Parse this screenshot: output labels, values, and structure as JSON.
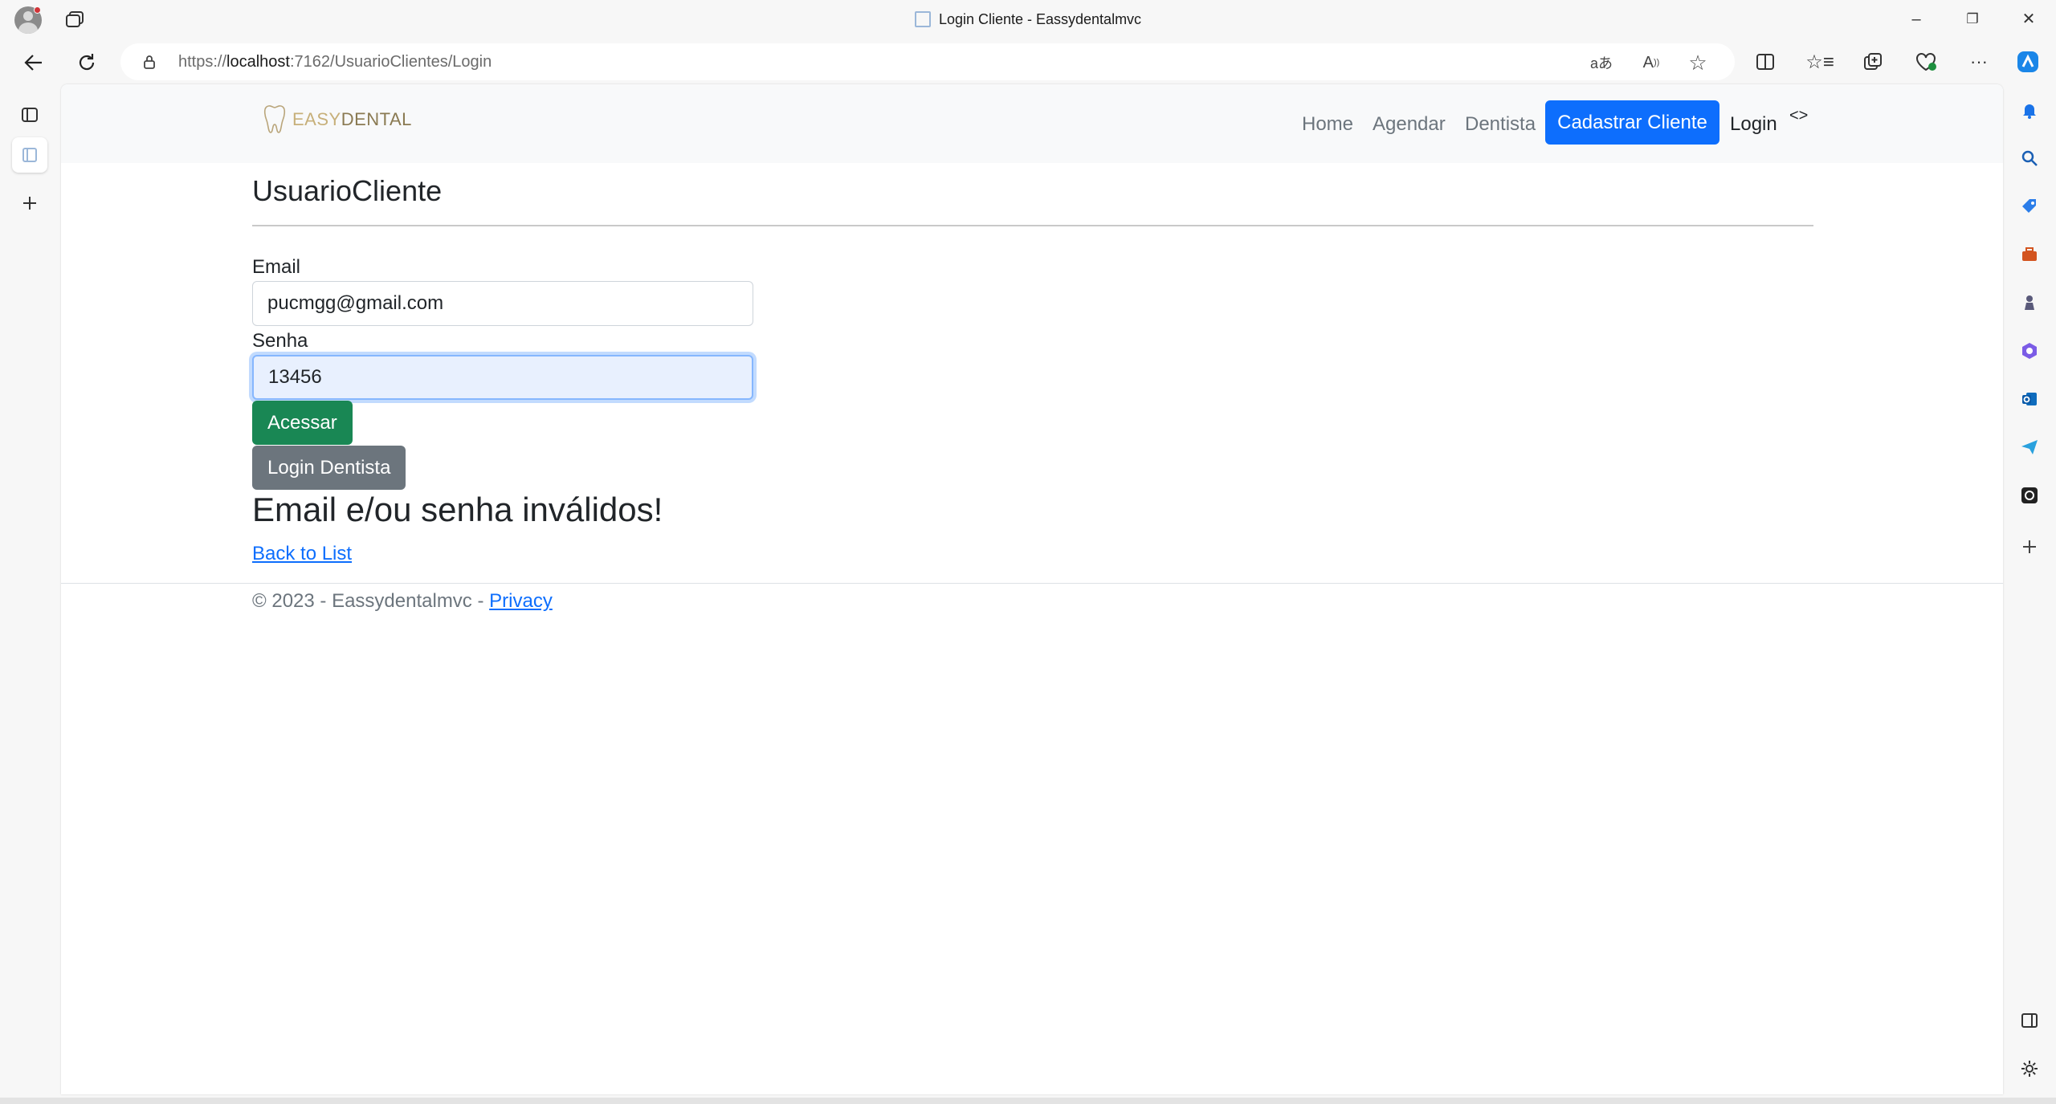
{
  "browser": {
    "window_title": "Login Cliente - Eassydentalmvc",
    "url_prefix": "https://",
    "url_host": "localhost",
    "url_rest": ":7162/UsuarioClientes/Login",
    "window_controls": {
      "minimize": "–",
      "restore": "❐",
      "close": "✕"
    },
    "more_label": "···"
  },
  "navbar": {
    "brand_prefix": "EASY",
    "brand_suffix": "DENTAL",
    "links": [
      "Home",
      "Agendar",
      "Dentista"
    ],
    "cta_label": "Cadastrar Cliente",
    "login_label": "Login",
    "chevrons": "<>"
  },
  "page": {
    "title": "UsuarioCliente",
    "email_label": "Email",
    "email_value": "pucmgg@gmail.com",
    "password_label": "Senha",
    "password_value": "13456",
    "submit_label": "Acessar",
    "dentist_login_label": "Login Dentista",
    "error_message": "Email e/ou senha inválidos!",
    "back_link": "Back to List"
  },
  "footer": {
    "copyright": "© 2023 - Eassydentalmvc - ",
    "privacy_link": "Privacy"
  },
  "colors": {
    "primary": "#0d6efd",
    "success": "#198754",
    "secondary": "#6c757d",
    "focus_fill": "#e8f0fe"
  }
}
